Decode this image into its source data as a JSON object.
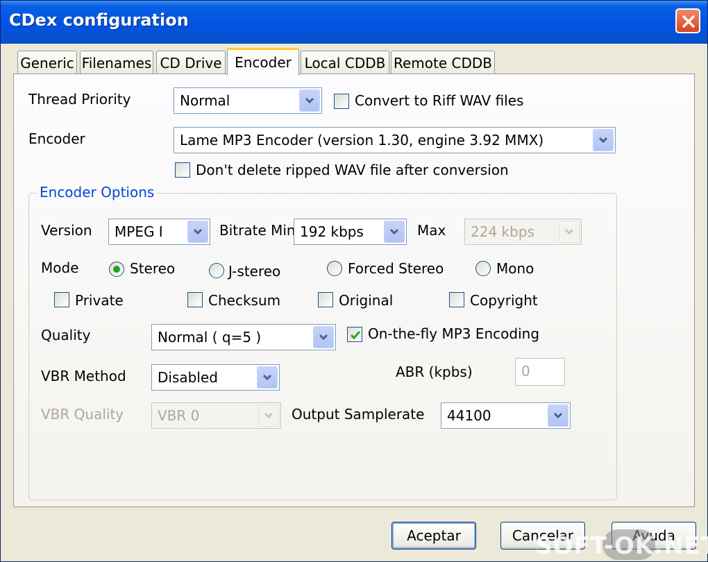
{
  "window": {
    "title": "CDex configuration"
  },
  "tabs": [
    {
      "label": "Generic"
    },
    {
      "label": "Filenames"
    },
    {
      "label": "CD Drive"
    },
    {
      "label": "Encoder",
      "active": true
    },
    {
      "label": "Local CDDB"
    },
    {
      "label": "Remote CDDB"
    }
  ],
  "thread_priority": {
    "label": "Thread Priority",
    "value": "Normal"
  },
  "convert_riff": {
    "label": "Convert to Riff WAV files",
    "checked": false
  },
  "encoder": {
    "label": "Encoder",
    "value": "Lame MP3 Encoder (version 1.30, engine 3.92 MMX)"
  },
  "dont_delete": {
    "label": "Don't delete ripped WAV file after conversion",
    "checked": false
  },
  "encoder_options": {
    "title": "Encoder Options",
    "version": {
      "label": "Version",
      "value": "MPEG I"
    },
    "bitrate_min": {
      "label": "Bitrate Min",
      "value": "192 kbps"
    },
    "bitrate_max": {
      "label": "Max",
      "value": "224 kbps",
      "disabled": true
    },
    "mode": {
      "label": "Mode",
      "options": [
        "Stereo",
        "J-stereo",
        "Forced Stereo",
        "Mono"
      ],
      "selected": "Stereo"
    },
    "flags": [
      {
        "label": "Private",
        "checked": false
      },
      {
        "label": "Checksum",
        "checked": false
      },
      {
        "label": "Original",
        "checked": false
      },
      {
        "label": "Copyright",
        "checked": false
      }
    ],
    "quality": {
      "label": "Quality",
      "value": "Normal ( q=5 )"
    },
    "on_the_fly": {
      "label": "On-the-fly MP3 Encoding",
      "checked": true
    },
    "vbr_method": {
      "label": "VBR Method",
      "value": "Disabled"
    },
    "abr": {
      "label": "ABR (kpbs)",
      "value": "0",
      "disabled": true
    },
    "vbr_quality": {
      "label": "VBR Quality",
      "value": "VBR 0",
      "disabled": true
    },
    "output_samplerate": {
      "label": "Output Samplerate",
      "value": "44100"
    }
  },
  "buttons": {
    "ok": "Aceptar",
    "cancel": "Cancelar",
    "help": "Ayuda"
  },
  "watermark": {
    "text": "SOFT-OK.NET"
  },
  "colors": {
    "titlebar": "#0054e3",
    "group_title": "#0046d5",
    "check_mark": "#21a121",
    "active_tab_accent": "#ffc83c"
  }
}
